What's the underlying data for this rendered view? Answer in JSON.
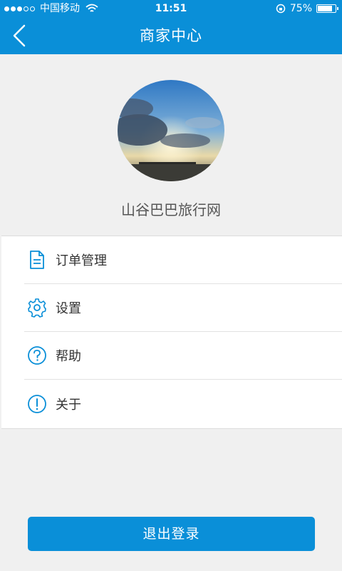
{
  "status_bar": {
    "carrier": "中国移动",
    "time": "11:51",
    "battery": "75%",
    "battery_level": 0.75
  },
  "navbar": {
    "title": "商家中心",
    "back_icon": "chevron-left-icon"
  },
  "profile": {
    "name": "山谷巴巴旅行网"
  },
  "menu": {
    "items": [
      {
        "label": "订单管理",
        "icon": "document-icon"
      },
      {
        "label": "设置",
        "icon": "gear-icon"
      },
      {
        "label": "帮助",
        "icon": "question-circle-icon"
      },
      {
        "label": "关于",
        "icon": "exclamation-circle-icon"
      }
    ]
  },
  "logout": {
    "label": "退出登录"
  },
  "colors": {
    "accent": "#0a8fd8",
    "background": "#f0f0f0"
  }
}
